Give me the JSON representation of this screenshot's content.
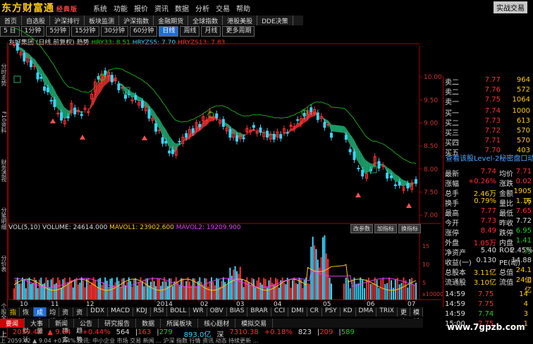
{
  "app": {
    "logo": "东方财富通",
    "edition": "经典版",
    "quick_trade": "实战交易",
    "wmb": "-□×"
  },
  "menu": [
    "系统",
    "功能",
    "报价",
    "资讯",
    "数据",
    "分析",
    "交易",
    "帮助"
  ],
  "tabs": [
    "首页",
    "自选股",
    "沪深排行",
    "板块监测",
    "沪深指数",
    "金融期货",
    "全球指数",
    "港股美股",
    "DDE决策"
  ],
  "periods": {
    "day_select": "5 日",
    "min1": "1分钟",
    "min5": "5分钟",
    "min15": "15分钟",
    "min30": "30分钟",
    "min60": "60分钟",
    "day": "日线",
    "week": "周线",
    "month": "月线",
    "more": "更多周期"
  },
  "chart_title": {
    "name": "友好集团 (日线,前复权)",
    "trend": "趋势",
    "l1": "HRY33: 8.51",
    "l2": "HRYZS5: 7.70",
    "l3": "HRYZS13: 7.83"
  },
  "sidebar": [
    "分时走势",
    "F10资料",
    "财务透视",
    "分笔明细",
    "分价表",
    "个股全景"
  ],
  "vol": {
    "label": "VOL(5,10)",
    "volume": "VOLUME: 24614.000",
    "m1": "MAVOL1: 23902.600",
    "m2": "MAVOL2: 19209.900",
    "btn1": "改参数",
    "btn2": "加指标",
    "btn3": "换指标"
  },
  "indicator_tabs": [
    "指标",
    "恢复默认",
    "成交量",
    "均线",
    "资金博弈",
    "资金趋势",
    "DDX",
    "MACD",
    "KDJ",
    "RSI",
    "BOLL",
    "WR",
    "OBV",
    "BIAS",
    "BRAR",
    "CCI",
    "DMI",
    "CR",
    "PSY",
    "KD",
    "DMA",
    "TRIX",
    "更多",
    "模板"
  ],
  "news_tabs": [
    "要闻",
    "大事",
    "新闻",
    "公告",
    "研究报告",
    "数据",
    "所属板块",
    "核心题材",
    "模拟交易"
  ],
  "index_bar": {
    "sh": "2059.42",
    "sh_chg": "9.04",
    "sh_pct": "+0.44%",
    "sh_vol": "564",
    "sh_b": "163",
    "sh_amt": "279",
    "sh_money": "893.0亿",
    "sz_label": "深",
    "sz": "7310.38",
    "sz_pct": "+0.18%",
    "sz_vol": "823",
    "sz_b": "209",
    "sz_amt": "589"
  },
  "marquee": "上 2059.42 ▲ 9.04 +0.44% 快讯: 中小企业 市场 交易 新闻 ... 沪深 指数 行情 资讯 动态 持续更新 ...",
  "orderbook": {
    "asks": [
      {
        "label": "卖二",
        "price": "7.77",
        "vol": "964"
      },
      {
        "label": "卖二",
        "price": "7.76",
        "vol": "572"
      },
      {
        "label": "卖一",
        "price": "7.75",
        "vol": "1064"
      }
    ],
    "bids": [
      {
        "label": "买一",
        "price": "7.74",
        "vol": "1000"
      },
      {
        "label": "买二",
        "price": "7.73",
        "vol": "613"
      },
      {
        "label": "买三",
        "price": "7.72",
        "vol": "570"
      },
      {
        "label": "买四",
        "price": "7.71",
        "vol": "570"
      },
      {
        "label": "买五",
        "price": "7.70",
        "vol": "403"
      }
    ]
  },
  "level2": "查看该股Level-2秘密盘口动向",
  "quote": [
    {
      "l1": "最新",
      "v1": "7.74",
      "l2": "均价",
      "v2": "7.71"
    },
    {
      "l1": "涨幅",
      "v1": "+0.26%",
      "l2": "涨跌",
      "v2": "0.02"
    },
    {
      "l1": "总手",
      "v1": "2.46万",
      "l2": "金额",
      "v2": "1905万"
    },
    {
      "l1": "换手",
      "v1": "0.79%",
      "l2": "量比",
      "v2": "1.16"
    },
    {
      "l1": "最高",
      "v1": "7.77",
      "l2": "最低",
      "v2": "7.65"
    },
    {
      "l1": "今开",
      "v1": "7.73",
      "l2": "昨收",
      "v2": "7.72"
    },
    {
      "l1": "涨停",
      "v1": "8.49",
      "l2": "跌停",
      "v2": "6.95"
    },
    {
      "l1": "外盘",
      "v1": "1.05万",
      "l2": "内盘",
      "v2": "1.41万"
    },
    {
      "l1": "净资产",
      "v1": "5.40",
      "l2": "ROE",
      "v2": "2.45%"
    },
    {
      "l1": "收益(一)",
      "v1": "0.130",
      "l2": "PE(动)",
      "v2": "14.88"
    },
    {
      "l1": "总股本",
      "v1": "3.11亿",
      "l2": "总值",
      "v2": "24.1亿"
    },
    {
      "l1": "流通股",
      "v1": "3.10亿",
      "l2": "流值",
      "v2": "24.0亿"
    }
  ],
  "ticks": [
    {
      "t": "14:59",
      "p": "7.75",
      "v": "14"
    },
    {
      "t": "14:59",
      "p": "7.75",
      "v": "4"
    },
    {
      "t": "14:59",
      "p": "7.74",
      "v": "3"
    },
    {
      "t": "15:00",
      "p": "7.75",
      "v": "1"
    }
  ],
  "watermark": "www.7gpzb.com",
  "price_axis": [
    "10.00",
    "9.50",
    "9.00",
    "8.50",
    "8.00",
    "7.50",
    "7.00"
  ],
  "vol_axis": [
    "15",
    "10",
    "5",
    "x10000"
  ],
  "date_axis": [
    "10",
    "11",
    "12",
    "2014",
    "02",
    "03",
    "04",
    "05",
    "06",
    "07"
  ]
}
